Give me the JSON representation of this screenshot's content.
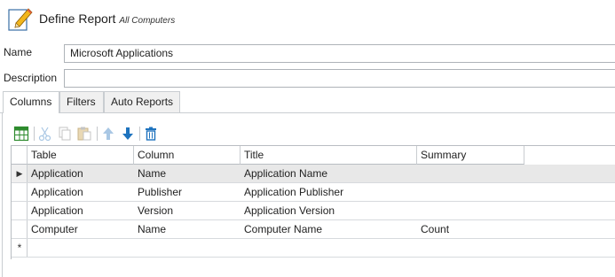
{
  "header": {
    "title": "Define Report",
    "subtitle": "All Computers",
    "icon": "edit-report-icon"
  },
  "form": {
    "name_label": "Name",
    "name_value": "Microsoft Applications",
    "description_label": "Description",
    "description_value": ""
  },
  "tabs": [
    {
      "label": "Columns",
      "active": true
    },
    {
      "label": "Filters",
      "active": false
    },
    {
      "label": "Auto Reports",
      "active": false
    }
  ],
  "toolbar": {
    "icons": [
      "add-column-icon",
      "cut-icon",
      "copy-icon",
      "paste-icon",
      "move-up-icon",
      "move-down-icon",
      "delete-icon"
    ]
  },
  "grid": {
    "headers": [
      "Table",
      "Column",
      "Title",
      "Summary"
    ],
    "rows": [
      {
        "table": "Application",
        "column": "Name",
        "title": "Application Name",
        "summary": "",
        "selected": true
      },
      {
        "table": "Application",
        "column": "Publisher",
        "title": "Application Publisher",
        "summary": ""
      },
      {
        "table": "Application",
        "column": "Version",
        "title": "Application Version",
        "summary": ""
      },
      {
        "table": "Computer",
        "column": "Name",
        "title": "Computer Name",
        "summary": "Count"
      }
    ],
    "current_row_glyph": "▶",
    "new_row_glyph": "*"
  },
  "colors": {
    "accent_blue": "#1e73be",
    "green": "#2e8b2e",
    "selected_row": "#e8e8e8"
  }
}
